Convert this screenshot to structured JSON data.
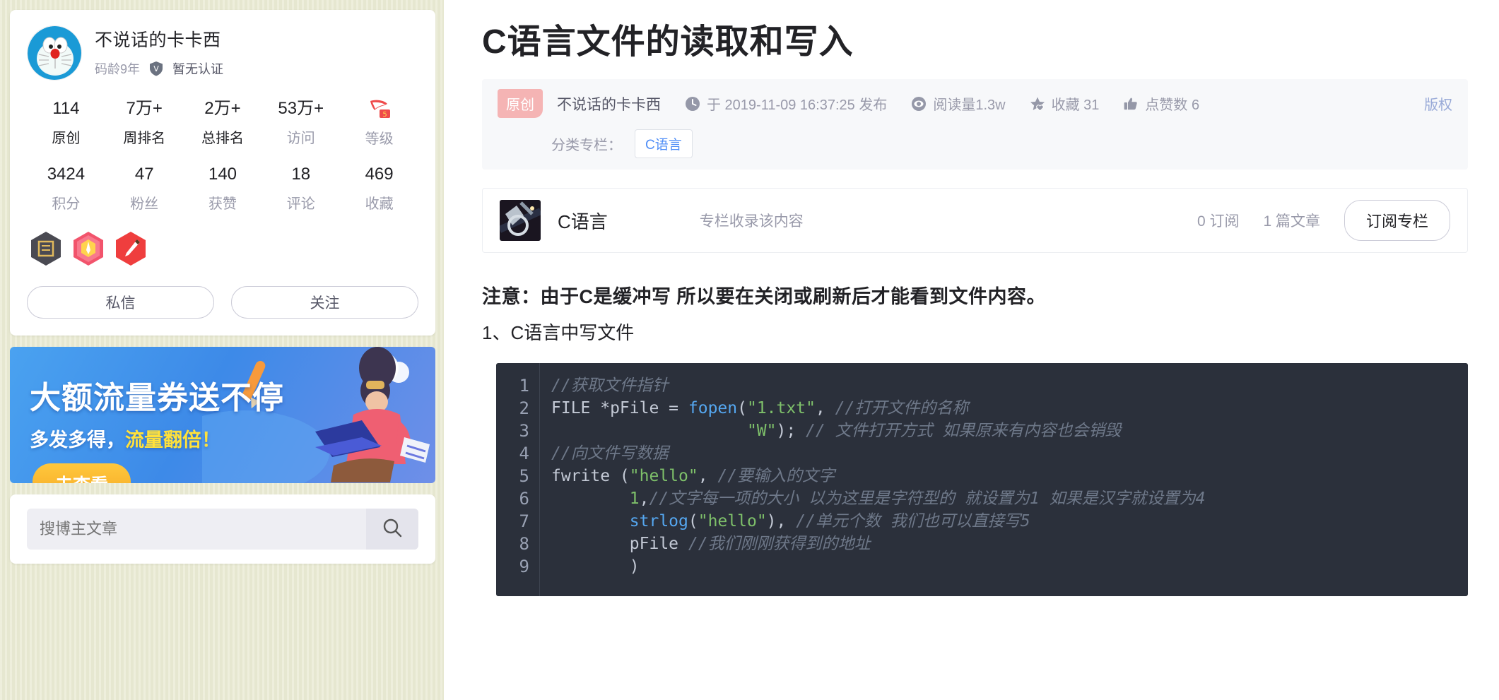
{
  "sidebar": {
    "profile": {
      "username": "不说话的卡卡西",
      "code_age": "码龄9年",
      "certification": "暂无认证",
      "stats_row1": [
        {
          "num": "114",
          "label": "原创",
          "muted": false
        },
        {
          "num": "7万+",
          "label": "周排名",
          "muted": false
        },
        {
          "num": "2万+",
          "label": "总排名",
          "muted": false
        },
        {
          "num": "53万+",
          "label": "访问",
          "muted": true
        },
        {
          "num": "",
          "label": "等级",
          "muted": true
        }
      ],
      "stats_row2": [
        {
          "num": "3424",
          "label": "积分"
        },
        {
          "num": "47",
          "label": "粉丝"
        },
        {
          "num": "140",
          "label": "获赞"
        },
        {
          "num": "18",
          "label": "评论"
        },
        {
          "num": "469",
          "label": "收藏"
        }
      ],
      "message_button": "私信",
      "follow_button": "关注"
    },
    "ad": {
      "title": "大额流量券送不停",
      "subtitle_normal": "多发多得，",
      "subtitle_highlight": "流量翻倍！",
      "button": "去查看"
    },
    "search": {
      "placeholder": "搜博主文章",
      "value": ""
    }
  },
  "article": {
    "title": "C语言文件的读取和写入",
    "original_badge": "原创",
    "author": "不说话的卡卡西",
    "publish_time": "于 2019-11-09 16:37:25 发布",
    "read_count": "阅读量1.3w",
    "favorite": "收藏 31",
    "likes": "点赞数 6",
    "copyright": "版权",
    "category_label": "分类专栏：",
    "category_tag": "C语言"
  },
  "column": {
    "name": "C语言",
    "description": "专栏收录该内容",
    "subscribers": "0 订阅",
    "article_count": "1 篇文章",
    "subscribe_button": "订阅专栏"
  },
  "content": {
    "note": "注意：由于C是缓冲写 所以要在关闭或刷新后才能看到文件内容。",
    "section": "1、C语言中写文件"
  },
  "code": {
    "line_numbers": [
      "1",
      "2",
      "3",
      "4",
      "5",
      "6",
      "7",
      "8",
      "9"
    ],
    "lines": [
      [
        {
          "t": "//获取文件指针",
          "c": "c-cmt"
        }
      ],
      [
        {
          "t": "FILE *pFile = ",
          "c": "c-kw"
        },
        {
          "t": "fopen",
          "c": "c-fn"
        },
        {
          "t": "(",
          "c": "c-kw"
        },
        {
          "t": "\"1.txt\"",
          "c": "c-str"
        },
        {
          "t": ", ",
          "c": "c-kw"
        },
        {
          "t": "//打开文件的名称",
          "c": "c-cmt"
        }
      ],
      [
        {
          "t": "                    ",
          "c": "c-kw"
        },
        {
          "t": "\"W\"",
          "c": "c-str"
        },
        {
          "t": "); ",
          "c": "c-kw"
        },
        {
          "t": "// 文件打开方式 如果原来有内容也会销毁",
          "c": "c-cmt"
        }
      ],
      [
        {
          "t": "//向文件写数据",
          "c": "c-cmt"
        }
      ],
      [
        {
          "t": "fwrite (",
          "c": "c-kw"
        },
        {
          "t": "\"hello\"",
          "c": "c-str"
        },
        {
          "t": ", ",
          "c": "c-kw"
        },
        {
          "t": "//要输入的文字",
          "c": "c-cmt"
        }
      ],
      [
        {
          "t": "        ",
          "c": "c-kw"
        },
        {
          "t": "1",
          "c": "c-num"
        },
        {
          "t": ",",
          "c": "c-kw"
        },
        {
          "t": "//文字每一项的大小 以为这里是字符型的 就设置为1 如果是汉字就设置为4",
          "c": "c-cmt"
        }
      ],
      [
        {
          "t": "        ",
          "c": "c-kw"
        },
        {
          "t": "strlog",
          "c": "c-fn"
        },
        {
          "t": "(",
          "c": "c-kw"
        },
        {
          "t": "\"hello\"",
          "c": "c-str"
        },
        {
          "t": "), ",
          "c": "c-kw"
        },
        {
          "t": "//单元个数 我们也可以直接写5",
          "c": "c-cmt"
        }
      ],
      [
        {
          "t": "        pFile ",
          "c": "c-kw"
        },
        {
          "t": "//我们刚刚获得到的地址",
          "c": "c-cmt"
        }
      ],
      [
        {
          "t": "        )",
          "c": "c-kw"
        }
      ]
    ]
  },
  "icons": {
    "shield": "shield-check-icon",
    "clock": "clock-icon",
    "eye": "eye-icon",
    "star": "star-icon",
    "thumb": "thumbs-up-icon",
    "search": "search-icon",
    "level_badge": "level-badge-icon"
  },
  "colors": {
    "page_bg": "#e9ead2",
    "accent_blue": "#4f8ef7",
    "code_bg": "#2b303b",
    "orig_badge": "#f5b4b4"
  }
}
